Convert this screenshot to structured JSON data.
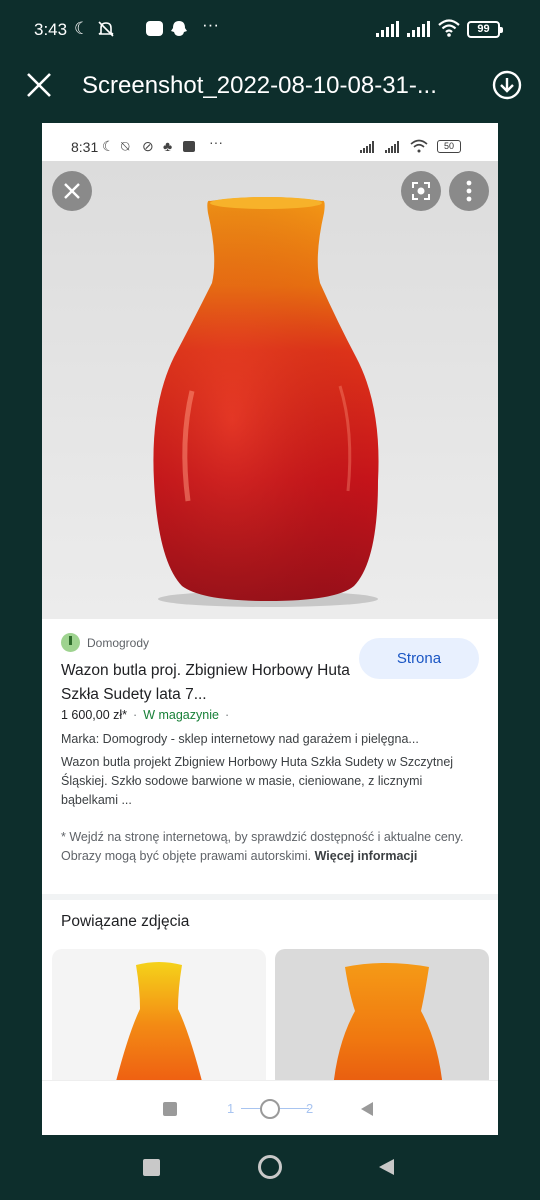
{
  "outer_status": {
    "time": "3:43",
    "battery": "99"
  },
  "viewer": {
    "title": "Screenshot_2022-08-10-08-31-..."
  },
  "inner_status": {
    "time": "8:31",
    "battery": "50"
  },
  "result": {
    "source": "Domogrody",
    "title": "Wazon butla proj. Zbigniew Horbowy Huta Szkła Sudety lata 7...",
    "visit_button": "Strona",
    "price": "1 600,00 zł*",
    "stock": "W magazynie",
    "brand_line": "Marka: Domogrody - sklep internetowy nad garażem i pielęgna...",
    "description": "Wazon butla projekt Zbigniew Horbowy Huta Szkła Sudety w Szczytnej Śląskiej. Szkło sodowe barwione w masie, cieniowane, z licznymi bąbelkami ...",
    "notice": "* Wejdź na stronę internetową, by sprawdzić dostępność i aktualne ceny. Obrazy mogą być objęte prawami autorskimi.",
    "more_info": "Więcej informacji"
  },
  "related": {
    "heading": "Powiązane zdjęcia"
  },
  "pager": {
    "page1": "1",
    "page2": "2"
  },
  "icons": [
    "close-icon",
    "download-icon",
    "lens-icon",
    "more-vert-icon",
    "square-icon",
    "home-circle-icon",
    "back-triangle-icon"
  ]
}
